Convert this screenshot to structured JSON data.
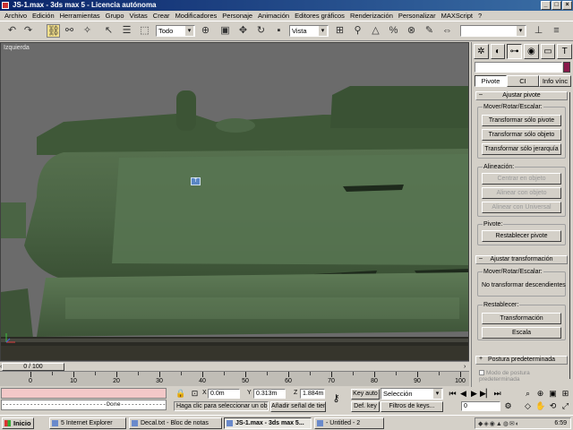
{
  "window": {
    "title": "JS-1.max - 3ds max 5 - Licencia autónoma"
  },
  "menu": [
    "Archivo",
    "Edición",
    "Herramientas",
    "Grupo",
    "Vistas",
    "Crear",
    "Modificadores",
    "Personaje",
    "Animación",
    "Editores gráficos",
    "Renderización",
    "Personalizar",
    "MAXScript",
    "?"
  ],
  "toolbar": {
    "selection_filter": "Todo",
    "reference_coord": "Vista",
    "named_selection": ""
  },
  "viewport": {
    "label": "Izquierda",
    "pivot_marker": "T̅"
  },
  "command_panel": {
    "object_name": "",
    "subtabs": [
      "Pivote",
      "CI",
      "Info vínc"
    ],
    "rollout_pivot": {
      "title": "Ajustar pivote",
      "group_move": "Mover/Rotar/Escalar:",
      "btn_pivot_only": "Transformar sólo pivote",
      "btn_object_only": "Transformar sólo objeto",
      "btn_hierarchy_only": "Transformar sólo jerarquía",
      "group_align": "Alineación:",
      "btn_center": "Centrar en objeto",
      "btn_align_object": "Alinear con objeto",
      "btn_align_world": "Alinear con Universal",
      "group_pivot": "Pivote:",
      "btn_reset_pivot": "Restablecer pivote"
    },
    "rollout_transform": {
      "title": "Ajustar transformación",
      "group_move": "Mover/Rotar/Escalar:",
      "btn_no_children": "No transformar descendientes",
      "group_reset": "Restablecer:",
      "btn_transform": "Transformación",
      "btn_scale": "Escala"
    },
    "rollout_pose": {
      "title": "Postura predeterminada",
      "checkbox": "Modo de postura predeterminada"
    }
  },
  "timeline": {
    "frame_display": "0 / 100",
    "ticks": [
      "0",
      "10",
      "20",
      "30",
      "40",
      "50",
      "60",
      "70",
      "80",
      "90",
      "100"
    ]
  },
  "status": {
    "listener_output": "------------------------------Done--------------------",
    "prompt": "Haga clic para seleccionar un obje",
    "add_key": "Añadir señal de tiem",
    "x_label": "X",
    "x_value": "0.0m",
    "y_label": "Y",
    "y_value": "0.313m",
    "z_label": "Z",
    "z_value": "1.884m",
    "auto_key": "Key auto",
    "set_key": "Def. key",
    "key_mode": "Selección",
    "key_filters": "Filtros de keys...",
    "frame": "0"
  },
  "taskbar": {
    "start": "Inicio",
    "tasks": [
      "5 Internet Explorer",
      "Decal.txt - Bloc de notas",
      "JS-1.max - 3ds max 5...",
      "- Untitled - 2"
    ],
    "clock": "6:59"
  }
}
